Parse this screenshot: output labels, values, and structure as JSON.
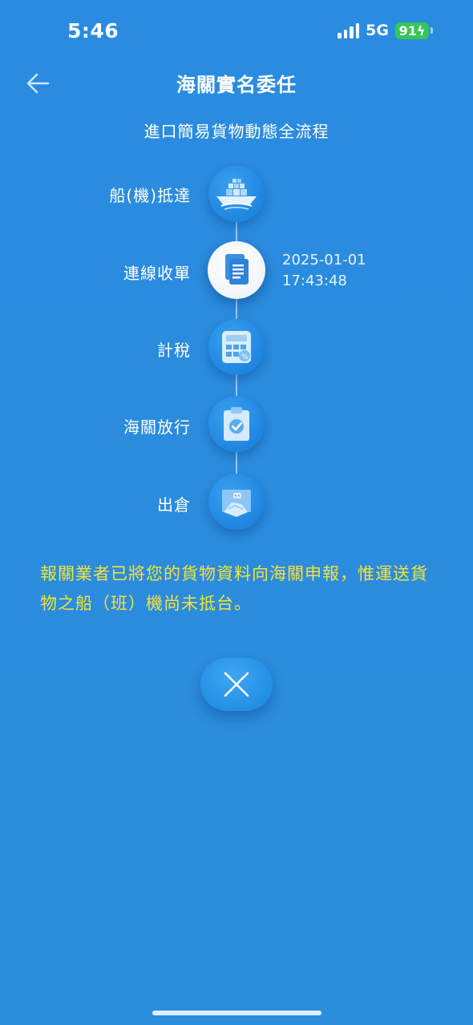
{
  "status_bar": {
    "time": "5:46",
    "network": "5G",
    "battery": "91"
  },
  "header": {
    "back_icon": "arrow-left-icon",
    "title": "海關實名委任"
  },
  "subtitle": "進口簡易貨物動態全流程",
  "steps": [
    {
      "label": "船(機)抵達",
      "icon": "ship-plane-icon",
      "active": false,
      "time": ""
    },
    {
      "label": "連線收單",
      "icon": "document-icon",
      "active": true,
      "time_date": "2025-01-01",
      "time_clock": "17:43:48"
    },
    {
      "label": "計稅",
      "icon": "calculator-icon",
      "active": false,
      "time": ""
    },
    {
      "label": "海關放行",
      "icon": "clipboard-check-icon",
      "active": false,
      "time": ""
    },
    {
      "label": "出倉",
      "icon": "warehouse-handshake-icon",
      "active": false,
      "time": ""
    }
  ],
  "notice": "報關業者已將您的貨物資料向海關申報，惟運送貨物之船（班）機尚未抵台。",
  "close_icon": "close-icon",
  "colors": {
    "background": "#2b8cdc",
    "notice_text": "#f3e33a",
    "battery": "#34c759"
  }
}
